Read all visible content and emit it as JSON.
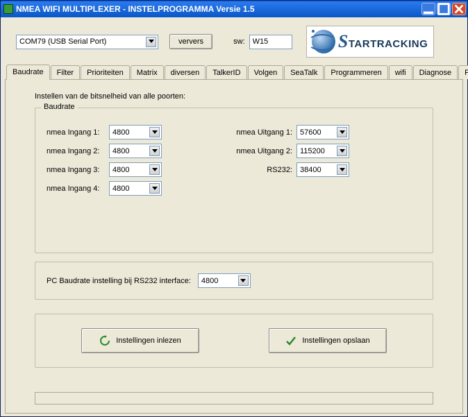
{
  "titlebar": {
    "title": "NMEA WIFI MULTIPLEXER - INSTELPROGRAMMA Versie 1.5"
  },
  "toolbar": {
    "port": "COM79 (USB Serial Port)",
    "refresh": "ververs",
    "sw_label": "sw:",
    "sw_value": "W15",
    "logo_text": "TARTRACKING"
  },
  "tabs": [
    {
      "label": "Baudrate",
      "active": true
    },
    {
      "label": "Filter"
    },
    {
      "label": "Prioriteiten"
    },
    {
      "label": "Matrix"
    },
    {
      "label": "diversen"
    },
    {
      "label": "TalkerID"
    },
    {
      "label": "Volgen"
    },
    {
      "label": "SeaTalk"
    },
    {
      "label": "Programmeren"
    },
    {
      "label": "wifi"
    },
    {
      "label": "Diagnose"
    },
    {
      "label": "Polar"
    }
  ],
  "page": {
    "intro": "Instellen van de bitsnelheid van alle poorten:",
    "group_title": "Baudrate",
    "rows": {
      "in1_label": "nmea Ingang 1:",
      "in1_value": "4800",
      "in2_label": "nmea Ingang 2:",
      "in2_value": "4800",
      "in3_label": "nmea Ingang 3:",
      "in3_value": "4800",
      "in4_label": "nmea Ingang 4:",
      "in4_value": "4800",
      "out1_label": "nmea Uitgang 1:",
      "out1_value": "57600",
      "out2_label": "nmea Uitgang 2:",
      "out2_value": "115200",
      "rs232_label": "RS232:",
      "rs232_value": "38400"
    },
    "pcbaud_label": "PC Baudrate instelling bij RS232 interface:",
    "pcbaud_value": "4800"
  },
  "buttons": {
    "read": "Instellingen inlezen",
    "save": "Instellingen opslaan"
  }
}
